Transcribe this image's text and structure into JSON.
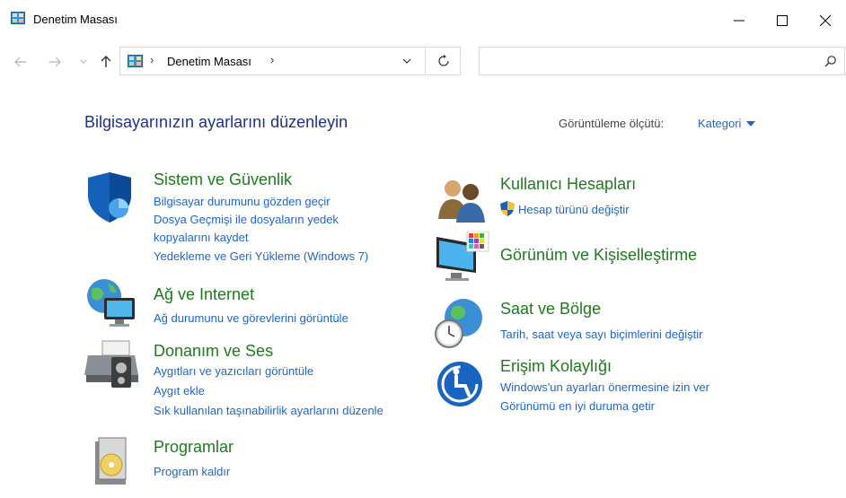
{
  "window": {
    "title": "Denetim Masası",
    "minimize_glyph": "—",
    "maximize_glyph": "☐",
    "close_glyph": "✕"
  },
  "navigation": {
    "back_glyph": "←",
    "forward_glyph": "→",
    "recent_glyph": "⌄",
    "up_glyph": "↑",
    "address": "Denetim Masası",
    "separator": "›",
    "refresh_glyph": "↻",
    "search_placeholder": ""
  },
  "content": {
    "heading": "Bilgisayarınızın ayarlarını düzenleyin",
    "view_by_label": "Görüntüleme ölçütü:",
    "view_by_value": "Kategori"
  },
  "categories_left": [
    {
      "icon": "shield-icon",
      "title": "Sistem ve Güvenlik",
      "links": [
        "Bilgisayar durumunu gözden geçir",
        "Dosya Geçmişi ile dosyaların yedek",
        "kopyalarını kaydet",
        "Yedekleme ve Geri Yükleme (Windows 7)"
      ]
    },
    {
      "icon": "network-globe-icon",
      "title": "Ağ ve Internet",
      "links": [
        "Ağ durumunu ve görevlerini görüntüle"
      ]
    },
    {
      "icon": "printer-icon",
      "title": "Donanım ve Ses",
      "links": [
        "Aygıtları ve yazıcıları görüntüle",
        "Aygıt ekle",
        "Sık kullanılan taşınabilirlik ayarlarını düzenle"
      ]
    },
    {
      "icon": "programs-icon",
      "title": "Programlar",
      "links": [
        "Program kaldır"
      ]
    }
  ],
  "categories_right": [
    {
      "icon": "users-icon",
      "title": "Kullanıcı Hesapları",
      "links": [
        "Hesap türünü değiştir"
      ]
    },
    {
      "icon": "monitor-icon",
      "title": "Görünüm ve Kişiselleştirme",
      "links": []
    },
    {
      "icon": "clock-globe-icon",
      "title": "Saat ve Bölge",
      "links": [
        "Tarih, saat veya sayı biçimlerini değiştir"
      ]
    },
    {
      "icon": "accessibility-icon",
      "title": "Erişim Kolaylığı",
      "links": [
        "Windows'un ayarları önermesine izin ver",
        "Görünümü en iyi duruma getir"
      ]
    }
  ],
  "colors": {
    "heading": "#1e3287",
    "category_title": "#1e7a1e",
    "link": "#1e66c8"
  }
}
